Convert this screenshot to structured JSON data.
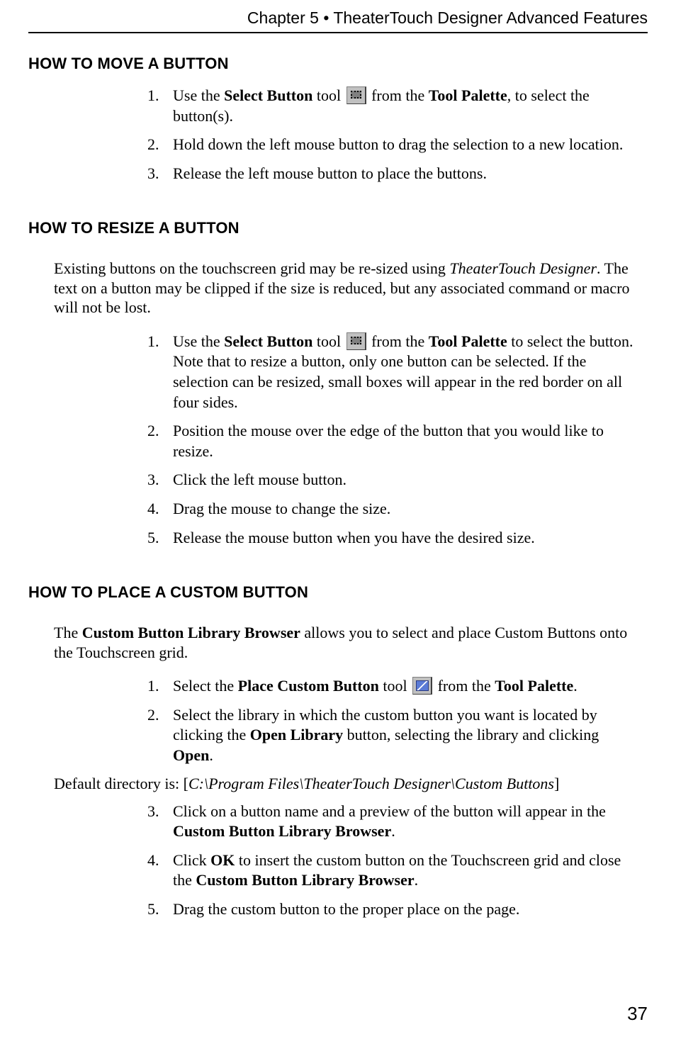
{
  "header": "Chapter 5 • TheaterTouch Designer Advanced Features",
  "page_number": "37",
  "sections": {
    "move": {
      "heading": "HOW TO MOVE A BUTTON",
      "step1": {
        "t1": "Use the ",
        "b1": "Select Button",
        "t2": " tool ",
        "t3": " from the ",
        "b2": "Tool Palette",
        "t4": ", to select the button(s)."
      },
      "step2": "Hold down the left mouse button to drag the selection to a new location.",
      "step3": "Release the left mouse button to place the buttons."
    },
    "resize": {
      "heading": "HOW TO RESIZE A BUTTON",
      "intro": {
        "t1": "Existing buttons on the touchscreen grid may be re-sized using ",
        "i1": "TheaterTouch Designer",
        "t2": ". The text on a button may be clipped if the size is reduced, but any associated command or macro will not be lost."
      },
      "step1": {
        "t1": "Use the ",
        "b1": "Select Button",
        "t2": " tool ",
        "t3": " from the ",
        "b2": "Tool Palette",
        "t4": " to select the button. Note that to resize a button, only one button can be selected.  If the selection can be resized, small boxes will appear in the red border on all four sides."
      },
      "step2": "Position the mouse over the edge of the button that you would like to resize.",
      "step3": "Click the left mouse button.",
      "step4": "Drag the mouse to change the size.",
      "step5": "Release the mouse button when you have the desired size."
    },
    "custom": {
      "heading": "HOW TO PLACE A CUSTOM BUTTON",
      "intro": {
        "t1": "The ",
        "b1": "Custom Button Library Browser",
        "t2": " allows you to select and place Custom Buttons onto the Touchscreen grid."
      },
      "step1": {
        "t1": "Select the ",
        "b1": "Place Custom Button",
        "t2": " tool ",
        "t3": " from the ",
        "b2": "Tool Palette",
        "t4": "."
      },
      "step2": {
        "t1": "Select the library in which the custom button you want is located by clicking the ",
        "b1": "Open Library",
        "t2": " button, selecting the library and clicking ",
        "b2": "Open",
        "t3": "."
      },
      "default_dir": {
        "t1": "Default directory is: [",
        "i1": "C:\\Program Files\\TheaterTouch Designer\\Custom Buttons",
        "t2": "]"
      },
      "step3": {
        "t1": "Click on a button name and a preview of the button will appear in the ",
        "b1": "Custom Button Library Browser",
        "t2": "."
      },
      "step4": {
        "t1": "Click ",
        "b1": "OK",
        "t2": " to insert the custom button on the Touchscreen grid and close the ",
        "b2": "Custom Button Library Browser",
        "t3": "."
      },
      "step5": "Drag the custom button to the proper place on the page."
    }
  }
}
